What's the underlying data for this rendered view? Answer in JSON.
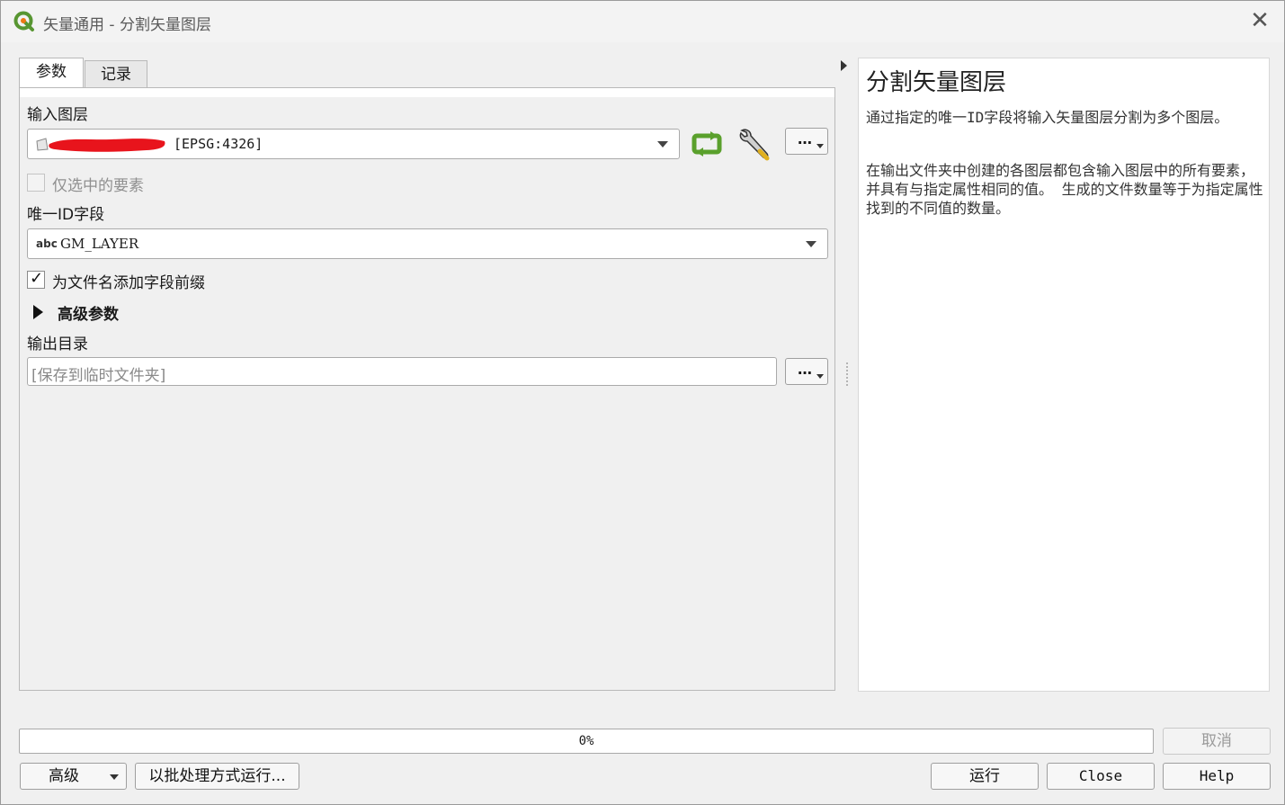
{
  "window": {
    "title": "矢量通用 - 分割矢量图层"
  },
  "tabs": [
    {
      "label": "参数",
      "active": true
    },
    {
      "label": "记录",
      "active": false
    }
  ],
  "params": {
    "input_layer_label": "输入图层",
    "input_layer_value": "[EPSG:4326]",
    "selected_only_label": "仅选中的要素",
    "selected_only_checked": false,
    "unique_id_label": "唯一ID字段",
    "unique_id_type": "abc",
    "unique_id_value": "GM_LAYER",
    "prefix_label": "为文件名添加字段前缀",
    "prefix_checked": true,
    "advanced_label": "高级参数",
    "output_label": "输出目录",
    "output_placeholder": "[保存到临时文件夹]",
    "dots": "…"
  },
  "help": {
    "title": "分割矢量图层",
    "para1": "通过指定的唯一ID字段将输入矢量图层分割为多个图层。",
    "para2": "在输出文件夹中创建的各图层都包含输入图层中的所有要素，并具有与指定属性相同的值。 生成的文件数量等于为指定属性找到的不同值的数量。"
  },
  "progress": {
    "value": 0,
    "text": "0%"
  },
  "buttons": {
    "cancel": "取消",
    "advanced": "高级",
    "batch": "以批处理方式运行...",
    "run": "运行",
    "close": "Close",
    "help": "Help"
  },
  "colors": {
    "qgis_green": "#589632",
    "qgis_yellow": "#ee7913",
    "refresh_green": "#5aa02c",
    "redaction": "#e8141c"
  }
}
